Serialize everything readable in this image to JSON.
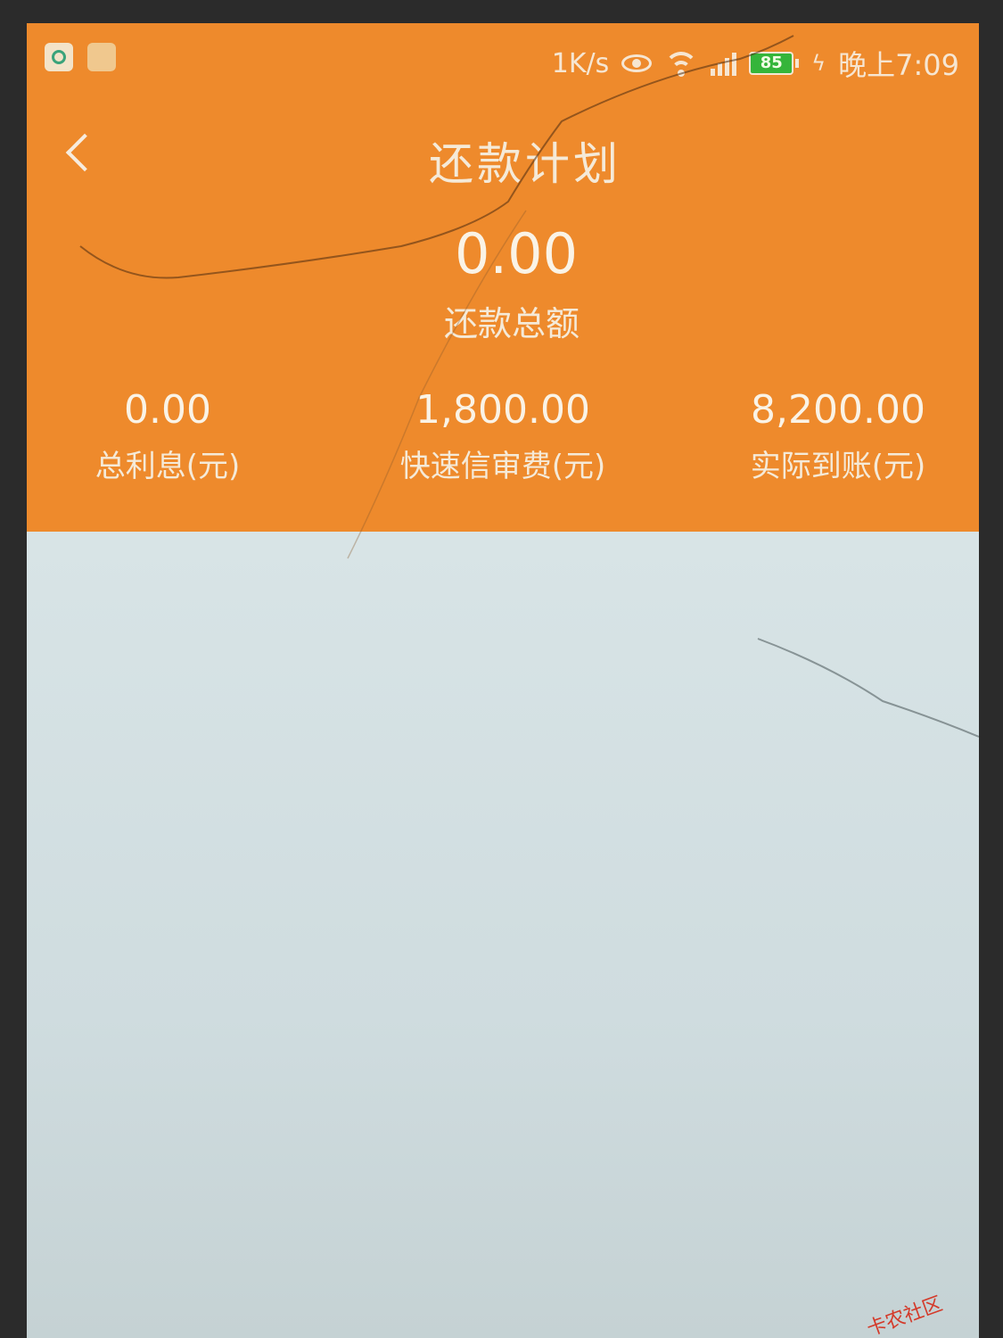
{
  "status_bar": {
    "net_speed": "1K/s",
    "battery_level": "85",
    "time": "晚上7:09",
    "icons": [
      "app-icon",
      "app-icon",
      "eye-icon",
      "wifi-icon",
      "signal-icon",
      "battery-icon",
      "charging-icon"
    ]
  },
  "header": {
    "title": "还款计划",
    "back_icon": "chevron-left-icon"
  },
  "summary": {
    "total_amount": "0.00",
    "total_label": "还款总额"
  },
  "stats": [
    {
      "value": "0.00",
      "label": "总利息(元)"
    },
    {
      "value": "1,800.00",
      "label": "快速信审费(元)"
    },
    {
      "value": "8,200.00",
      "label": "实际到账(元)"
    }
  ],
  "watermark": "卡农社区",
  "colors": {
    "header_bg": "#ee8a2c",
    "body_bg": "#d8e4e6",
    "battery": "#35b53a"
  }
}
